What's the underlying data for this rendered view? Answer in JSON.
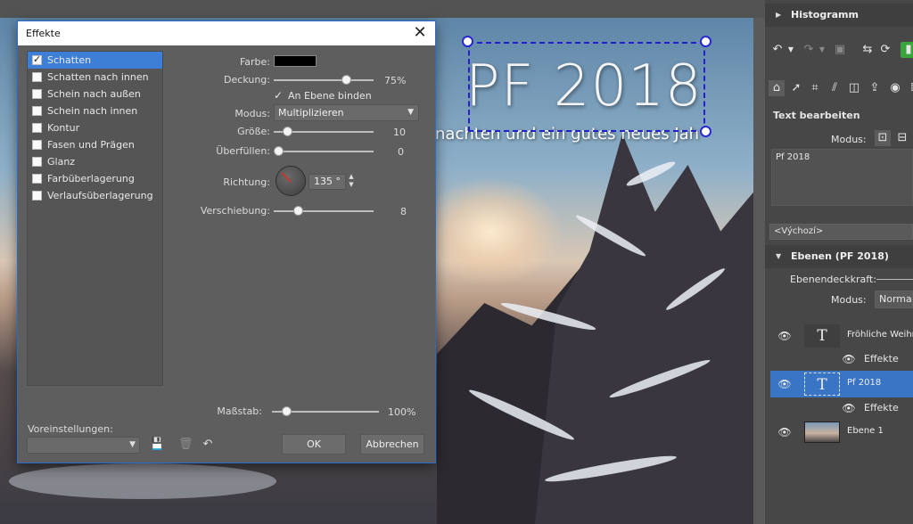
{
  "canvas": {
    "headline": "PF 2018",
    "subline": "nachten und ein gutes neues Jah"
  },
  "dialog": {
    "title": "Effekte",
    "close_icon": "close-icon",
    "effects": [
      {
        "label": "Schatten",
        "checked": true,
        "active": true
      },
      {
        "label": "Schatten nach innen",
        "checked": false
      },
      {
        "label": "Schein nach außen",
        "checked": false
      },
      {
        "label": "Schein nach innen",
        "checked": false
      },
      {
        "label": "Kontur",
        "checked": false
      },
      {
        "label": "Fasen und Prägen",
        "checked": false
      },
      {
        "label": "Glanz",
        "checked": false
      },
      {
        "label": "Farbüberlagerung",
        "checked": false
      },
      {
        "label": "Verlaufsüberlagerung",
        "checked": false
      }
    ],
    "params": {
      "color_label": "Farbe:",
      "color_value": "#000000",
      "opacity_label": "Deckung:",
      "opacity_value": "75%",
      "opacity_fraction": 0.75,
      "bind_label": "An Ebene binden",
      "bind_checked": true,
      "mode_label": "Modus:",
      "mode_value": "Multiplizieren",
      "size_label": "Größe:",
      "size_value": "10",
      "size_fraction": 0.1,
      "spread_label": "Überfüllen:",
      "spread_value": "0",
      "spread_fraction": 0,
      "direction_label": "Richtung:",
      "direction_value": "135 °",
      "direction_degrees": 135,
      "offset_label": "Verschiebung:",
      "offset_value": "8",
      "offset_fraction": 0.22,
      "scale_label": "Maßstab:",
      "scale_value": "100%",
      "scale_fraction": 0.1
    },
    "presets_label": "Voreinstellungen:",
    "presets_value": "",
    "ok_label": "OK",
    "cancel_label": "Abbrechen"
  },
  "panel": {
    "histogram_title": "Histogramm",
    "edit_text_title": "Text bearbeiten",
    "mode_label": "Modus:",
    "text_content": "Pf 2018",
    "style_preset": "<Výchozí>",
    "layers_title": "Ebenen (PF 2018)",
    "layer_opacity_label": "Ebenendeckkraft:",
    "layer_mode_label": "Modus:",
    "layer_mode_value": "Normal",
    "layers": [
      {
        "name": "Fröhliche Weihn",
        "type": "text",
        "selected": false,
        "sub": "Effekte"
      },
      {
        "name": "Pf 2018",
        "type": "text",
        "selected": true,
        "sub": "Effekte"
      },
      {
        "name": "Ebene 1",
        "type": "image",
        "selected": false
      }
    ]
  },
  "colors": {
    "accent": "#3d7fd6",
    "dialog_bg": "#5e5e5e",
    "panel_bg": "#474747",
    "selection": "#2222cc"
  }
}
